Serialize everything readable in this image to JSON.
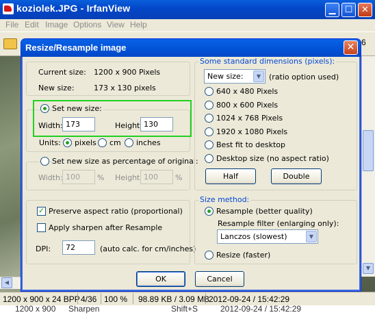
{
  "window": {
    "title": "koziolek.JPG - IrfanView"
  },
  "menu": [
    "File",
    "Edit",
    "Image",
    "Options",
    "View",
    "Help"
  ],
  "toolbar": {
    "value": "6"
  },
  "status": {
    "dims": "1200 x 900 x 24 BPP",
    "index": "4/36",
    "zoom": "100 %",
    "size": "98.89 KB / 3.09 MB",
    "datetime": "2012-09-24 / 15:42:29"
  },
  "bottom_strip": {
    "dims": "1200 x 900",
    "action": "Sharpen",
    "shortcut": "Shift+S",
    "datetime": "2012-09-24 / 15:42:29"
  },
  "dialog": {
    "title": "Resize/Resample image",
    "current_size_label": "Current size:",
    "current_size_value": "1200  x  900  Pixels",
    "new_size_label": "New size:",
    "new_size_value": "173  x  130  pixels",
    "set_new_size_label": "Set new size:",
    "width_label": "Width:",
    "width_value": "173",
    "height_label": "Height:",
    "height_value": "130",
    "units_label": "Units:",
    "units": [
      "pixels",
      "cm",
      "inches"
    ],
    "units_selected": "pixels",
    "percentage_label": "Set new size as percentage of original:",
    "pct_width_label": "Width:",
    "pct_width_value": "100",
    "pct_height_label": "Height:",
    "pct_height_value": "100",
    "pct_unit": "%",
    "preserve_aspect_label": "Preserve aspect ratio (proportional)",
    "preserve_aspect_checked": true,
    "apply_sharpen_label": "Apply sharpen after Resample",
    "apply_sharpen_checked": false,
    "dpi_label": "DPI:",
    "dpi_value": "72",
    "dpi_note": "(auto calc. for cm/inches)",
    "standard_dims_title": "Some standard dimensions (pixels):",
    "standard_select_value": "New size:",
    "ratio_note": "(ratio option used)",
    "standard_options": [
      "640 x 480 Pixels",
      "800 x 600 Pixels",
      "1024 x 768 Pixels",
      "1920 x 1080 Pixels",
      "Best fit to desktop",
      "Desktop size (no aspect ratio)"
    ],
    "half_button": "Half",
    "double_button": "Double",
    "size_method_title": "Size method:",
    "resample_label": "Resample (better quality)",
    "resample_filter_label": "Resample filter (enlarging only):",
    "resample_filter_value": "Lanczos (slowest)",
    "resize_label": "Resize (faster)",
    "method_selected": "Resample (better quality)",
    "ok_button": "OK",
    "cancel_button": "Cancel"
  }
}
